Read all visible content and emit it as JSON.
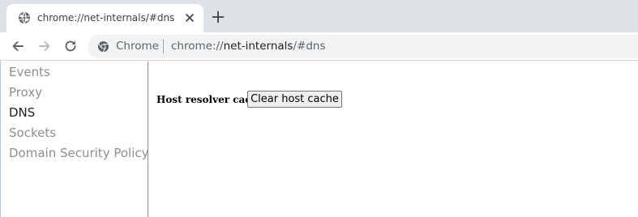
{
  "tab": {
    "title": "chrome://net-internals/#dns",
    "favicon": "globe-icon",
    "close_icon": "close-icon"
  },
  "new_tab_icon": "plus-icon",
  "toolbar": {
    "back_icon": "back-arrow-icon",
    "forward_icon": "forward-arrow-icon",
    "reload_icon": "reload-icon",
    "site_icon": "chrome-logo-icon",
    "site_chip": "Chrome",
    "url_scheme": "chrome://",
    "url_host": "net-internals",
    "url_rest": "/#dns"
  },
  "sidebar": {
    "items": [
      {
        "label": "Events",
        "selected": false
      },
      {
        "label": "Proxy",
        "selected": false
      },
      {
        "label": "DNS",
        "selected": true
      },
      {
        "label": "Sockets",
        "selected": false
      },
      {
        "label": "Domain Security Policy",
        "selected": false
      }
    ]
  },
  "dns": {
    "cache_label": "Host resolver cache",
    "clear_button": "Clear host cache"
  },
  "colors": {
    "tabstrip_bg": "#dee1e6",
    "omnibox_bg": "#f1f3f4",
    "sidebar_inactive": "#8e8e8e",
    "sidebar_active": "#202124"
  }
}
